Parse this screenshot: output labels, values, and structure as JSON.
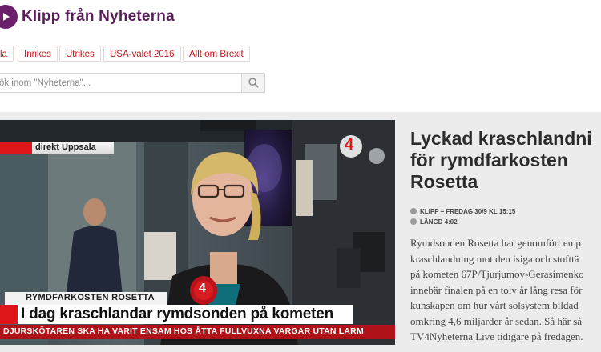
{
  "site": {
    "title": "Klipp från Nyheterna"
  },
  "tags": [
    {
      "label": "la"
    },
    {
      "label": "Inrikes"
    },
    {
      "label": "Utrikes"
    },
    {
      "label": "USA-valet 2016"
    },
    {
      "label": "Allt om Brexit"
    }
  ],
  "search": {
    "placeholder": "ök inom \"Nyheterna\"..."
  },
  "video": {
    "live_label": "direkt Uppsala",
    "lower_label": "RYMDFARKOSTEN ROSETTA",
    "headline": "I dag kraschlandar rymdsonden på kometen",
    "ticker": "DJURSKÖTAREN SKA HA VARIT ENSAM HOS ÅTTA FULLVUXNA VARGAR UTAN LARM",
    "channel_logo": "4",
    "mic_logo": "4"
  },
  "article": {
    "title_lines": [
      "Lyckad kraschlandni",
      "för rymdfarkosten",
      "Rosetta"
    ],
    "meta_klipp": "KLIPP – FREDAG 30/9 KL 15:15",
    "meta_length": "LÄNGD 4:02",
    "description_lines": [
      "Rymdsonden Rosetta har genomfört en p",
      "kraschlandning mot den isiga och stofttä",
      "på kometen 67P/Tjurjumov-Gerasimenko",
      "innebär finalen på en tolv år lång resa för",
      "kunskapen om hur vårt solsystem bildad",
      "omkring 4,6 miljarder år sedan. Så här så",
      "TV4Nyheterna Live tidigare på fredagen."
    ]
  },
  "colors": {
    "brand_purple": "#5a1f5a",
    "tag_red": "#c0161b",
    "tv4_red": "#e0161c"
  }
}
